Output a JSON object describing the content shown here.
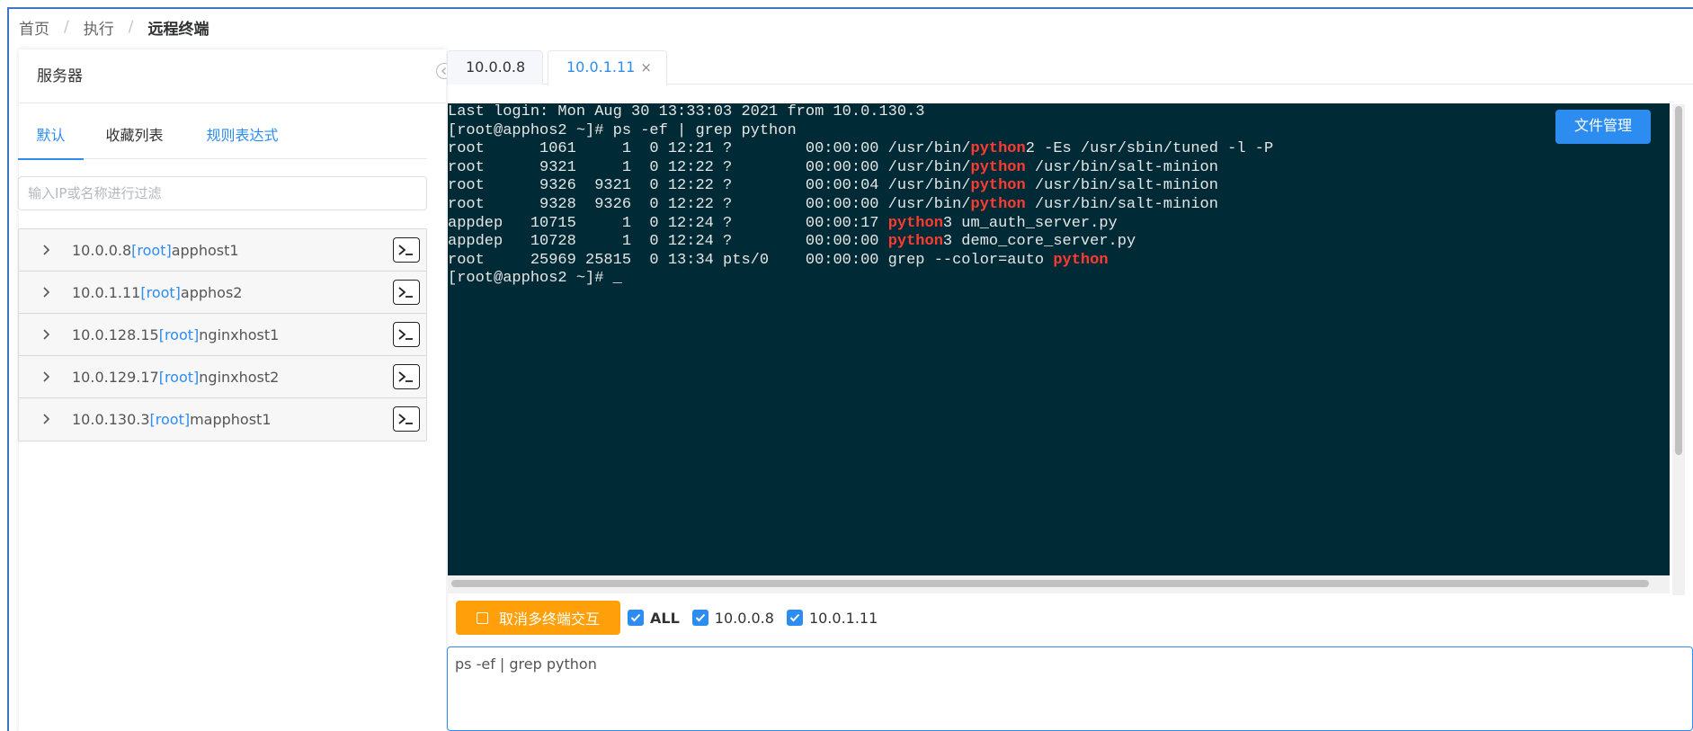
{
  "breadcrumb": [
    "首页",
    "执行",
    "远程终端"
  ],
  "left_panel": {
    "title": "服务器",
    "tabs": [
      "默认",
      "收藏列表",
      "规则表达式"
    ],
    "filter_placeholder": "输入IP或名称进行过滤",
    "servers": [
      {
        "ip": "10.0.0.8",
        "user": "[root]",
        "name": "apphost1"
      },
      {
        "ip": "10.0.1.11",
        "user": "[root]",
        "name": "apphos2"
      },
      {
        "ip": "10.0.128.15",
        "user": "[root]",
        "name": "nginxhost1"
      },
      {
        "ip": "10.0.129.17",
        "user": "[root]",
        "name": "nginxhost2"
      },
      {
        "ip": "10.0.130.3",
        "user": "[root]",
        "name": "mapphost1"
      }
    ]
  },
  "terminal_tabs": [
    {
      "label": "10.0.0.8"
    },
    {
      "label": "10.0.1.11",
      "close": "×"
    }
  ],
  "terminal": {
    "file_manager_label": "文件管理",
    "lines": [
      [
        {
          "t": "Last login: Mon Aug 30 13:33:03 2021 from 10.0.130.3"
        }
      ],
      [
        {
          "t": "[root@apphos2 ~]# ps -ef | grep python"
        }
      ],
      [
        {
          "t": "root      1061     1  0 12:21 ?        00:00:00 /usr/bin/"
        },
        {
          "t": "python",
          "h": true
        },
        {
          "t": "2 -Es /usr/sbin/tuned -l -P"
        }
      ],
      [
        {
          "t": "root      9321     1  0 12:22 ?        00:00:00 /usr/bin/"
        },
        {
          "t": "python",
          "h": true
        },
        {
          "t": " /usr/bin/salt-minion"
        }
      ],
      [
        {
          "t": "root      9326  9321  0 12:22 ?        00:00:04 /usr/bin/"
        },
        {
          "t": "python",
          "h": true
        },
        {
          "t": " /usr/bin/salt-minion"
        }
      ],
      [
        {
          "t": "root      9328  9326  0 12:22 ?        00:00:00 /usr/bin/"
        },
        {
          "t": "python",
          "h": true
        },
        {
          "t": " /usr/bin/salt-minion"
        }
      ],
      [
        {
          "t": "appdep   10715     1  0 12:24 ?        00:00:17 "
        },
        {
          "t": "python",
          "h": true
        },
        {
          "t": "3 um_auth_server.py"
        }
      ],
      [
        {
          "t": "appdep   10728     1  0 12:24 ?        00:00:00 "
        },
        {
          "t": "python",
          "h": true
        },
        {
          "t": "3 demo_core_server.py"
        }
      ],
      [
        {
          "t": "root     25969 25815  0 13:34 pts/0    00:00:00 grep --color=auto "
        },
        {
          "t": "python",
          "h": true
        }
      ],
      [
        {
          "t": "[root@apphos2 ~]# _"
        }
      ]
    ]
  },
  "multi_terminal": {
    "button_label": "取消多终端交互",
    "checkboxes": [
      "ALL",
      "10.0.0.8",
      "10.0.1.11"
    ]
  },
  "command_input": {
    "value": "ps -ef | grep python"
  },
  "colors": {
    "accent": "#2d8cf0",
    "warning": "#ff9f0a",
    "terminal_bg": "#002b36",
    "highlight": "#ff3b30"
  }
}
